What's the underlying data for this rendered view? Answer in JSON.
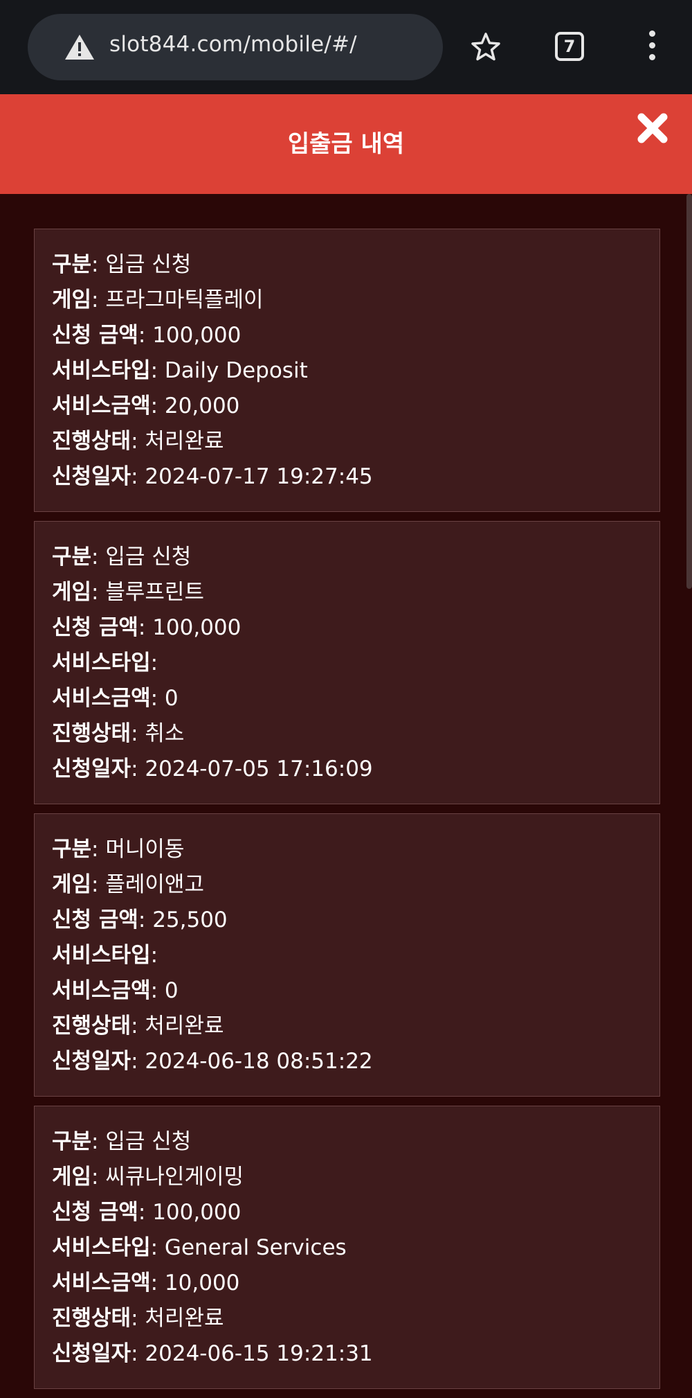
{
  "browser": {
    "url": "slot844.com/mobile/#/",
    "tab_count": "7",
    "icons": [
      "warning-icon",
      "star-icon",
      "tabs-icon",
      "menu-icon"
    ]
  },
  "modal": {
    "title": "입출금 내역",
    "close_icon": "close-icon",
    "header_color": "#dc4136"
  },
  "labels": {
    "type": "구분",
    "game": "게임",
    "amount": "신청 금액",
    "service_type": "서비스타입",
    "service_amount": "서비스금액",
    "status": "진행상태",
    "date": "신청일자"
  },
  "records": [
    {
      "type": "입금 신청",
      "game": "프라그마틱플레이",
      "amount": "100,000",
      "service_type": "Daily Deposit",
      "service_amount": "20,000",
      "status": "처리완료",
      "date": "2024-07-17 19:27:45"
    },
    {
      "type": "입금 신청",
      "game": "블루프린트",
      "amount": "100,000",
      "service_type": "",
      "service_amount": "0",
      "status": "취소",
      "date": "2024-07-05 17:16:09"
    },
    {
      "type": "머니이동",
      "game": "플레이앤고",
      "amount": "25,500",
      "service_type": "",
      "service_amount": "0",
      "status": "처리완료",
      "date": "2024-06-18 08:51:22"
    },
    {
      "type": "입금 신청",
      "game": "씨큐나인게이밍",
      "amount": "100,000",
      "service_type": "General Services",
      "service_amount": "10,000",
      "status": "처리완료",
      "date": "2024-06-15 19:21:31"
    }
  ]
}
